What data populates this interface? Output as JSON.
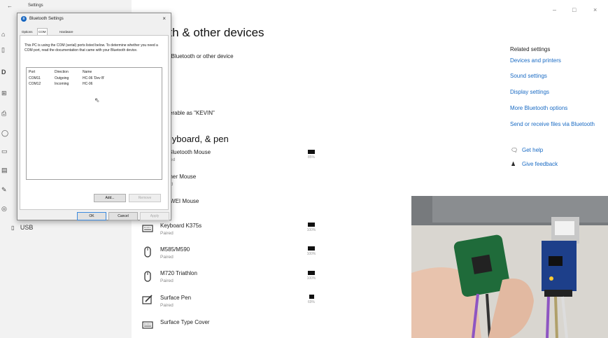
{
  "window": {
    "title": "Settings",
    "controls": {
      "minimize": "–",
      "maximize": "□",
      "close": "×"
    }
  },
  "sidebar": {
    "icons": [
      "home-icon",
      "bluetooth-icon",
      "printer-icon",
      "mouse-icon",
      "touchpad-icon",
      "typing-icon",
      "pen-icon",
      "autoplay-icon"
    ],
    "usb_label": "USB"
  },
  "main": {
    "title": "oth & other devices",
    "add_device": "d Bluetooth or other device",
    "toggle_label": "n",
    "discoverable": "verable as \"KEVIN\"",
    "section_title": "keyboard, & pen",
    "devices": [
      {
        "name": "Bluetooth Mouse",
        "status": "red",
        "icon": "",
        "battery": "85%"
      },
      {
        "name": "gner Mouse",
        "status": "red",
        "icon": "",
        "battery": ""
      },
      {
        "name": "AWEI  Mouse",
        "status": "ed",
        "icon": "",
        "battery": ""
      },
      {
        "name": "Keyboard K375s",
        "status": "Paired",
        "icon": "keyboard-icon",
        "battery": "100%"
      },
      {
        "name": "M585/M590",
        "status": "Paired",
        "icon": "mouse-icon",
        "battery": "100%"
      },
      {
        "name": "M720 Triathlon",
        "status": "Paired",
        "icon": "mouse-icon",
        "battery": "100%"
      },
      {
        "name": "Surface Pen",
        "status": "Paired",
        "icon": "pen-icon",
        "battery": "69%"
      },
      {
        "name": "Surface Type Cover",
        "status": "",
        "icon": "keyboard-icon",
        "battery": ""
      }
    ]
  },
  "related": {
    "heading": "Related settings",
    "links": [
      "Devices and printers",
      "Sound settings",
      "Display settings",
      "More Bluetooth options",
      "Send or receive files via Bluetooth"
    ],
    "help": [
      {
        "label": "Get help",
        "icon": "help-chat-icon"
      },
      {
        "label": "Give feedback",
        "icon": "feedback-icon"
      }
    ]
  },
  "dialog": {
    "title": "Bluetooth Settings",
    "close": "×",
    "tabs": [
      {
        "label": "Options",
        "active": false
      },
      {
        "label": "COM Ports",
        "active": true
      },
      {
        "label": "Hardware",
        "active": false
      }
    ],
    "info": "This PC is using the COM (serial) ports listed below. To determine whether you need a COM port, read the documentation that came with your Bluetooth device.",
    "columns": [
      "Port",
      "Direction",
      "Name"
    ],
    "rows": [
      [
        "COM11",
        "Outgoing",
        "HC-06 'Dev B'"
      ],
      [
        "COM12",
        "Incoming",
        "HC-06"
      ]
    ],
    "add_button": "Add...",
    "remove_button": "Remove",
    "ok_button": "OK",
    "cancel_button": "Cancel",
    "apply_button": "Apply"
  },
  "colors": {
    "link": "#1a6bc4",
    "accent": "#1565c0",
    "sidebar_bg": "#f2f2f2",
    "dialog_bg": "#f0f0f0"
  }
}
